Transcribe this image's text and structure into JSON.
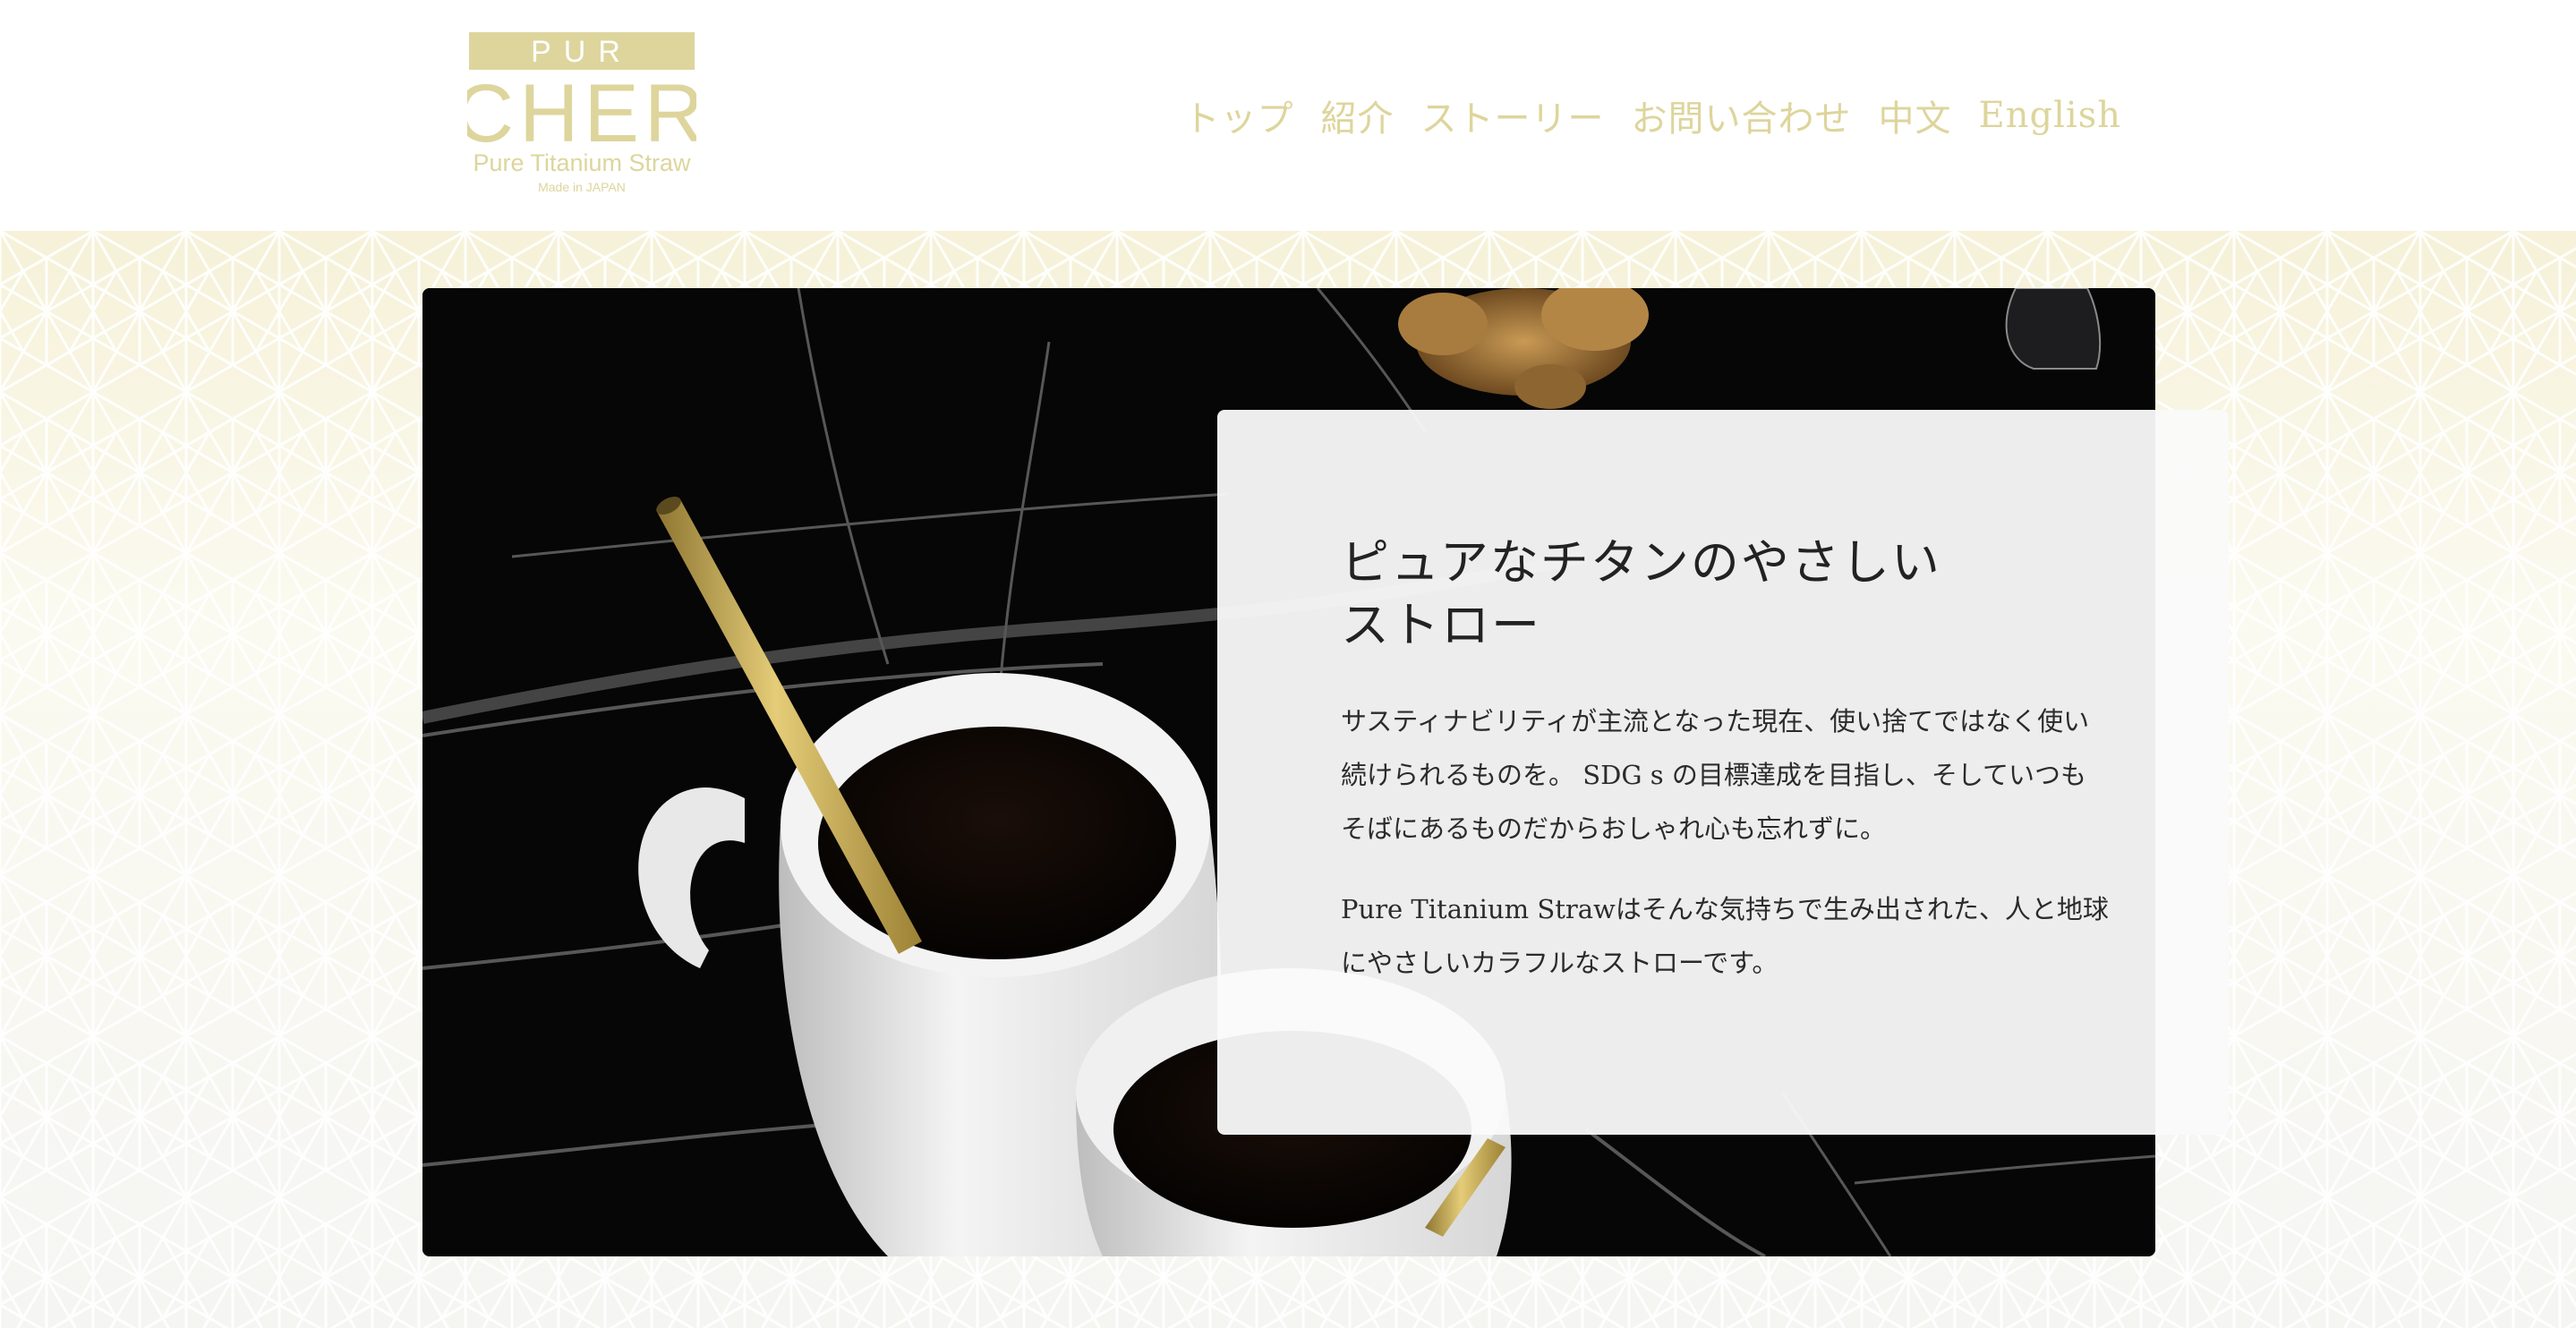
{
  "logo": {
    "top_text": "PUR",
    "main_text": "CHER",
    "tagline": "Pure Titanium Straw",
    "origin": "Made in JAPAN",
    "color": "#ddd59c"
  },
  "nav": {
    "items": [
      {
        "label": "トップ"
      },
      {
        "label": "紹介"
      },
      {
        "label": "ストーリー"
      },
      {
        "label": "お問い合わせ"
      },
      {
        "label": "中文"
      },
      {
        "label": "English"
      }
    ],
    "color": "#ddd59c"
  },
  "hero": {
    "heading_line1": "ピュアなチタンのやさしい",
    "heading_line2": "ストロー",
    "paragraph1": "サスティナビリティが主流となった現在、使い捨てではなく使い続けられるものを。 SDG s の目標達成を目指し、そしていつもそばにあるものだからおしゃれ心も忘れずに。",
    "paragraph2": "Pure Titanium Strawはそんな気持ちで生み出された、人と地球にやさしいカラフルなストローです。"
  },
  "colors": {
    "accent": "#ddd59c",
    "pattern_top": "#f6f1d8",
    "pattern_bottom": "#f5f5f2"
  }
}
